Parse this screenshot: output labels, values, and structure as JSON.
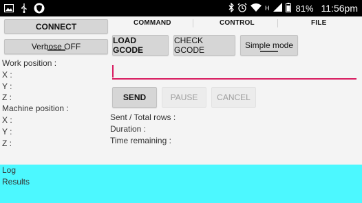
{
  "status_bar": {
    "battery_percent": "81%",
    "time": "11:56pm",
    "net_type": "H"
  },
  "left_panel": {
    "connect_label": "CONNECT",
    "verbose_label": "Verbose OFF",
    "work_position_label": "Work position :",
    "machine_position_label": "Machine position :",
    "work_axes": [
      "X :",
      "Y :",
      "Z :"
    ],
    "machine_axes": [
      "X :",
      "Y :",
      "Z :"
    ]
  },
  "tabs": [
    "COMMAND",
    "CONTROL",
    "FILE"
  ],
  "command_panel": {
    "load_gcode_label": "LOAD GCODE",
    "check_gcode_label": "CHECK GCODE",
    "simple_mode_label": "Simple mode",
    "gcode_input_value": "",
    "send_label": "SEND",
    "pause_label": "PAUSE",
    "cancel_label": "CANCEL",
    "sent_total_label": "Sent / Total rows :",
    "duration_label": "Duration :",
    "time_remaining_label": "Time remaining :"
  },
  "log_panel": {
    "log_label": "Log",
    "results_label": "Results"
  },
  "colors": {
    "accent": "#d81b60",
    "log_bg": "#4cf8ff",
    "status_bar": "#000000"
  }
}
